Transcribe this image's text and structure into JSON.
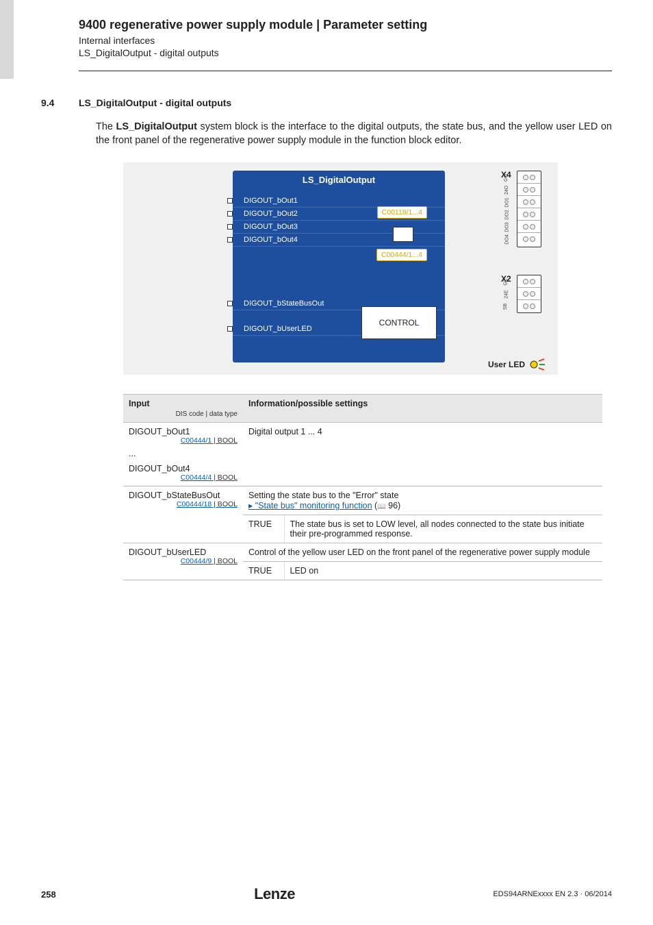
{
  "header": {
    "title": "9400 regenerative power supply module | Parameter setting",
    "sub1": "Internal interfaces",
    "sub2": "LS_DigitalOutput - digital outputs"
  },
  "section": {
    "num": "9.4",
    "title": "LS_DigitalOutput - digital outputs"
  },
  "body": {
    "p1_a": "The ",
    "p1_b": "LS_DigitalOutput",
    "p1_c": " system block is the interface to the digital outputs, the state bus, and the yellow user LED on the front panel of the regenerative power supply module in the function block editor."
  },
  "diagram": {
    "block_title": "LS_DigitalOutput",
    "inputs": [
      "DIGOUT_bOut1",
      "DIGOUT_bOut2",
      "DIGOUT_bOut3",
      "DIGOUT_bOut4"
    ],
    "inputs2": [
      "DIGOUT_bStateBusOut",
      "DIGOUT_bUserLED"
    ],
    "param1": "C00118/1...4",
    "param2": "C00444/1...4",
    "control": "CONTROL",
    "x4": "X4",
    "x4_pins": [
      "GO",
      "24O",
      "DO1",
      "DO2",
      "DO3",
      "DO4"
    ],
    "x2": "X2",
    "x2_pins": [
      "GE",
      "24E",
      "SB"
    ],
    "user_led": "User LED"
  },
  "table": {
    "col1": "Input",
    "dis_note": "DIS code | data type",
    "col2": "Information/possible settings",
    "rows": [
      {
        "name": "DIGOUT_bOut1",
        "link": "C00444/1",
        "type": " | BOOL",
        "ellipsis": "...",
        "name2": "DIGOUT_bOut4",
        "link2": "C00444/4",
        "type2": " | BOOL",
        "info": "Digital output 1 ... 4"
      },
      {
        "name": "DIGOUT_bStateBusOut",
        "link": "C00444/18",
        "type": " | BOOL",
        "info": "Setting the state bus to the \"Error\" state",
        "sublink": "\"State bus\" monitoring function",
        "subref": " 96)",
        "val": "TRUE",
        "valtext": "The state bus is set to LOW level, all nodes connected to the state bus initiate their pre-programmed response."
      },
      {
        "name": "DIGOUT_bUserLED",
        "link": "C00444/9",
        "type": " | BOOL",
        "info": "Control of the yellow user LED on the front panel of the regenerative power supply module",
        "val": "TRUE",
        "valtext": "LED on"
      }
    ]
  },
  "footer": {
    "page": "258",
    "brand": "Lenze",
    "doc": "EDS94ARNExxxx EN 2.3 · 06/2014"
  }
}
